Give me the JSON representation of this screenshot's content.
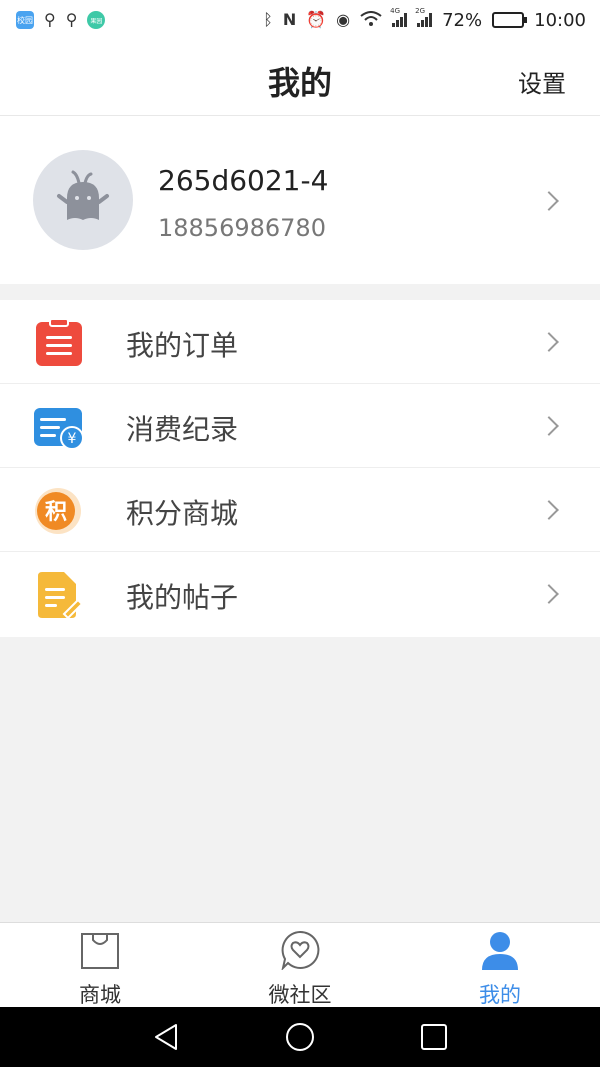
{
  "status_bar": {
    "app_badge_1": "校园",
    "app_badge_2": "果园",
    "network_1": "4G",
    "network_2": "2G",
    "battery_percent": "72%",
    "battery_level": 0.72,
    "time": "10:00"
  },
  "header": {
    "title": "我的",
    "settings_label": "设置"
  },
  "profile": {
    "username": "265d6021-4",
    "phone": "18856986780"
  },
  "menu": {
    "items": [
      {
        "label": "我的订单",
        "icon": "order-list-icon",
        "color": "#ee4b3d"
      },
      {
        "label": "消费纪录",
        "icon": "consumption-record-icon",
        "color": "#2f8fe0"
      },
      {
        "label": "积分商城",
        "icon": "points-mall-icon",
        "color": "#f08a24"
      },
      {
        "label": "我的帖子",
        "icon": "my-posts-icon",
        "color": "#f5b93a"
      }
    ],
    "points_badge_char": "积",
    "yen_char": "¥"
  },
  "tabbar": {
    "tabs": [
      {
        "label": "商城",
        "icon": "shopping-bag-icon"
      },
      {
        "label": "微社区",
        "icon": "heart-chat-icon"
      },
      {
        "label": "我的",
        "icon": "user-icon"
      }
    ],
    "active_color": "#3d8de8"
  }
}
